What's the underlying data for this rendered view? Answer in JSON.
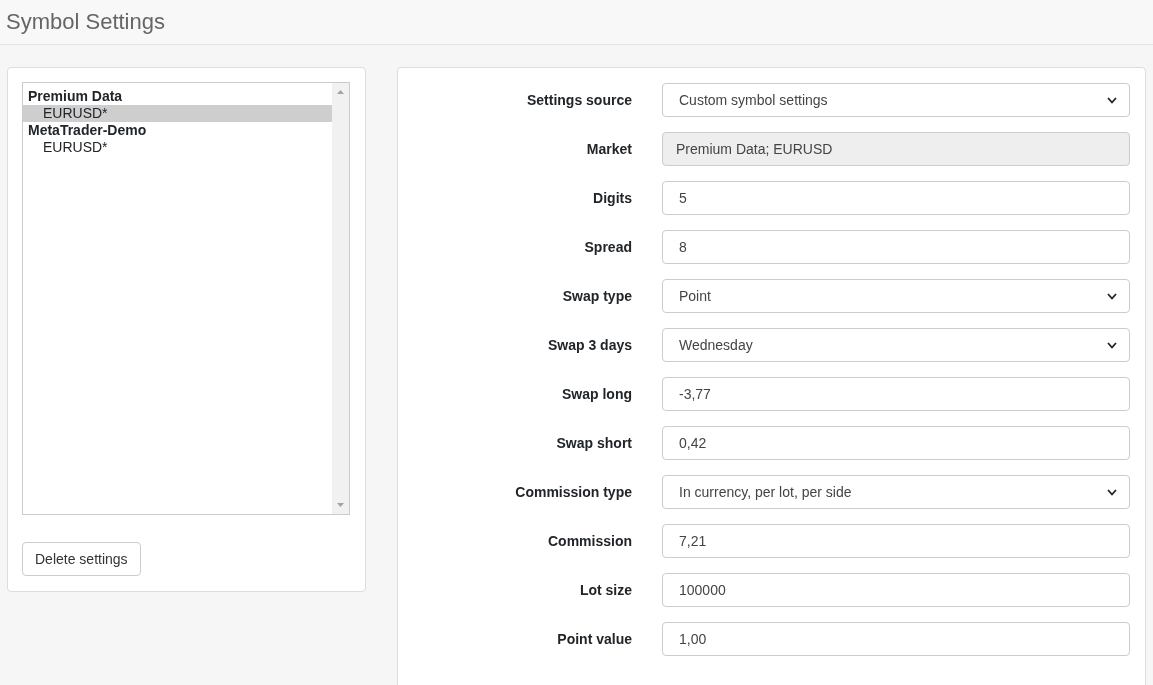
{
  "page": {
    "title": "Symbol Settings"
  },
  "symbol_tree": [
    {
      "label": "Premium Data",
      "children": [
        {
          "label": "EURUSD*",
          "selected": true
        }
      ]
    },
    {
      "label": "MetaTrader-Demo",
      "children": [
        {
          "label": "EURUSD*",
          "selected": false
        }
      ]
    }
  ],
  "delete_button": "Delete settings",
  "fields": [
    {
      "label": "Settings source",
      "kind": "select",
      "value": "Custom symbol settings",
      "disabled": false
    },
    {
      "label": "Market",
      "kind": "text",
      "value": "Premium Data; EURUSD",
      "disabled": true
    },
    {
      "label": "Digits",
      "kind": "text",
      "value": "5",
      "disabled": false
    },
    {
      "label": "Spread",
      "kind": "text",
      "value": "8",
      "disabled": false
    },
    {
      "label": "Swap type",
      "kind": "select",
      "value": "Point",
      "disabled": false
    },
    {
      "label": "Swap 3 days",
      "kind": "select",
      "value": "Wednesday",
      "disabled": false
    },
    {
      "label": "Swap long",
      "kind": "text",
      "value": "-3,77",
      "disabled": false
    },
    {
      "label": "Swap short",
      "kind": "text",
      "value": "0,42",
      "disabled": false
    },
    {
      "label": "Commission type",
      "kind": "select",
      "value": "In currency, per lot, per side",
      "disabled": false
    },
    {
      "label": "Commission",
      "kind": "text",
      "value": "7,21",
      "disabled": false
    },
    {
      "label": "Lot size",
      "kind": "text",
      "value": "100000",
      "disabled": false
    },
    {
      "label": "Point value",
      "kind": "text",
      "value": "1,00",
      "disabled": false
    }
  ]
}
